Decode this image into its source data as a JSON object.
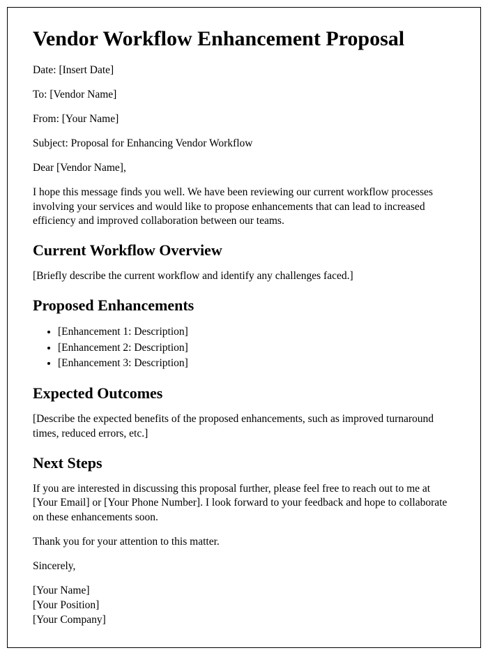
{
  "title": "Vendor Workflow Enhancement Proposal",
  "meta": {
    "date": "Date: [Insert Date]",
    "to": "To: [Vendor Name]",
    "from": "From: [Your Name]",
    "subject": "Subject: Proposal for Enhancing Vendor Workflow"
  },
  "salutation": "Dear [Vendor Name],",
  "intro": "I hope this message finds you well. We have been reviewing our current workflow processes involving your services and would like to propose enhancements that can lead to increased efficiency and improved collaboration between our teams.",
  "sections": {
    "overview": {
      "heading": "Current Workflow Overview",
      "body": "[Briefly describe the current workflow and identify any challenges faced.]"
    },
    "enhancements": {
      "heading": "Proposed Enhancements",
      "items": [
        "[Enhancement 1: Description]",
        "[Enhancement 2: Description]",
        "[Enhancement 3: Description]"
      ]
    },
    "outcomes": {
      "heading": "Expected Outcomes",
      "body": "[Describe the expected benefits of the proposed enhancements, such as improved turnaround times, reduced errors, etc.]"
    },
    "next": {
      "heading": "Next Steps",
      "body": "If you are interested in discussing this proposal further, please feel free to reach out to me at [Your Email] or [Your Phone Number]. I look forward to your feedback and hope to collaborate on these enhancements soon."
    }
  },
  "closing": {
    "thanks": "Thank you for your attention to this matter.",
    "signoff": "Sincerely,",
    "name": "[Your Name]",
    "position": "[Your Position]",
    "company": "[Your Company]"
  }
}
